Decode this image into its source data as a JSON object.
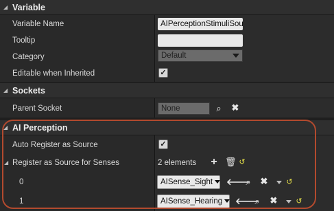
{
  "sections": {
    "variable": {
      "title": "Variable"
    },
    "sockets": {
      "title": "Sockets"
    },
    "ai_perception": {
      "title": "AI Perception"
    }
  },
  "variable": {
    "name_label": "Variable Name",
    "name_value": "AIPerceptionStimuliSou",
    "tooltip_label": "Tooltip",
    "tooltip_value": "",
    "category_label": "Category",
    "category_value": "Default",
    "editable_label": "Editable when Inherited",
    "editable_checked": true
  },
  "sockets": {
    "parent_label": "Parent Socket",
    "parent_value": "None"
  },
  "ai_perception": {
    "auto_register_label": "Auto Register as Source",
    "auto_register_checked": true,
    "senses_label": "Register as Source for Senses",
    "senses_count": "2 elements",
    "items": [
      {
        "index": "0",
        "value": "AISense_Sight"
      },
      {
        "index": "1",
        "value": "AISense_Hearing"
      }
    ]
  },
  "icons": {
    "collapse": "collapse-arrow-icon",
    "browse": "magnifier-icon",
    "clear": "x-icon",
    "add": "plus-icon",
    "delete": "trash-icon",
    "reset": "reset-arrow-icon",
    "use": "left-arrow-icon"
  },
  "colors": {
    "highlight": "#b34a2e",
    "reset_icon": "#e6e04a"
  }
}
